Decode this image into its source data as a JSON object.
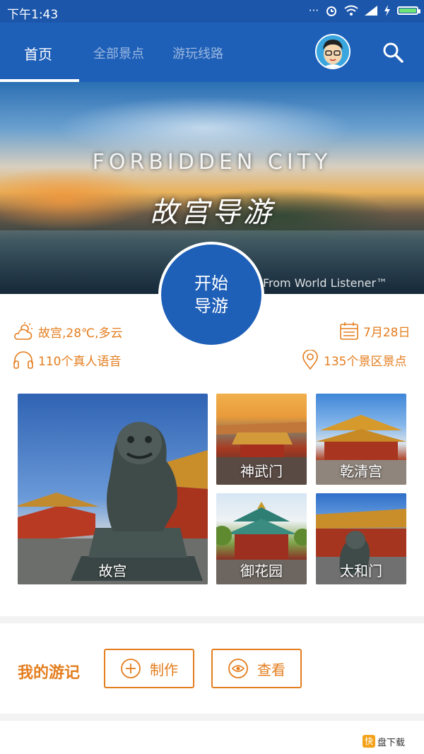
{
  "status_bar": {
    "time": "下午1:43",
    "battery_level": 1.0
  },
  "header": {
    "tabs": [
      {
        "label": "首页",
        "active": true
      },
      {
        "label": "全部景点",
        "active": false
      },
      {
        "label": "游玩线路",
        "active": false
      }
    ]
  },
  "banner": {
    "title": "FORBIDDEN CITY",
    "subtitle": "故宫导游",
    "credit": "From World Listener™"
  },
  "start_button": {
    "line1": "开始",
    "line2": "导游"
  },
  "info": {
    "weather": "故宫,28℃,多云",
    "date": "7月28日",
    "audio": "110个真人语音",
    "spots": "135个景区景点"
  },
  "tiles": [
    {
      "label": "故宫"
    },
    {
      "label": "神武门"
    },
    {
      "label": "乾清宫"
    },
    {
      "label": "御花园"
    },
    {
      "label": "太和门"
    }
  ],
  "travel_notes": {
    "title": "我的游记",
    "create_label": "制作",
    "view_label": "查看"
  },
  "watermark": {
    "logo": "快",
    "text": "盘下载"
  },
  "colors": {
    "primary": "#1e5fb8",
    "accent": "#e47d1e",
    "background": "#f2f2f2"
  }
}
